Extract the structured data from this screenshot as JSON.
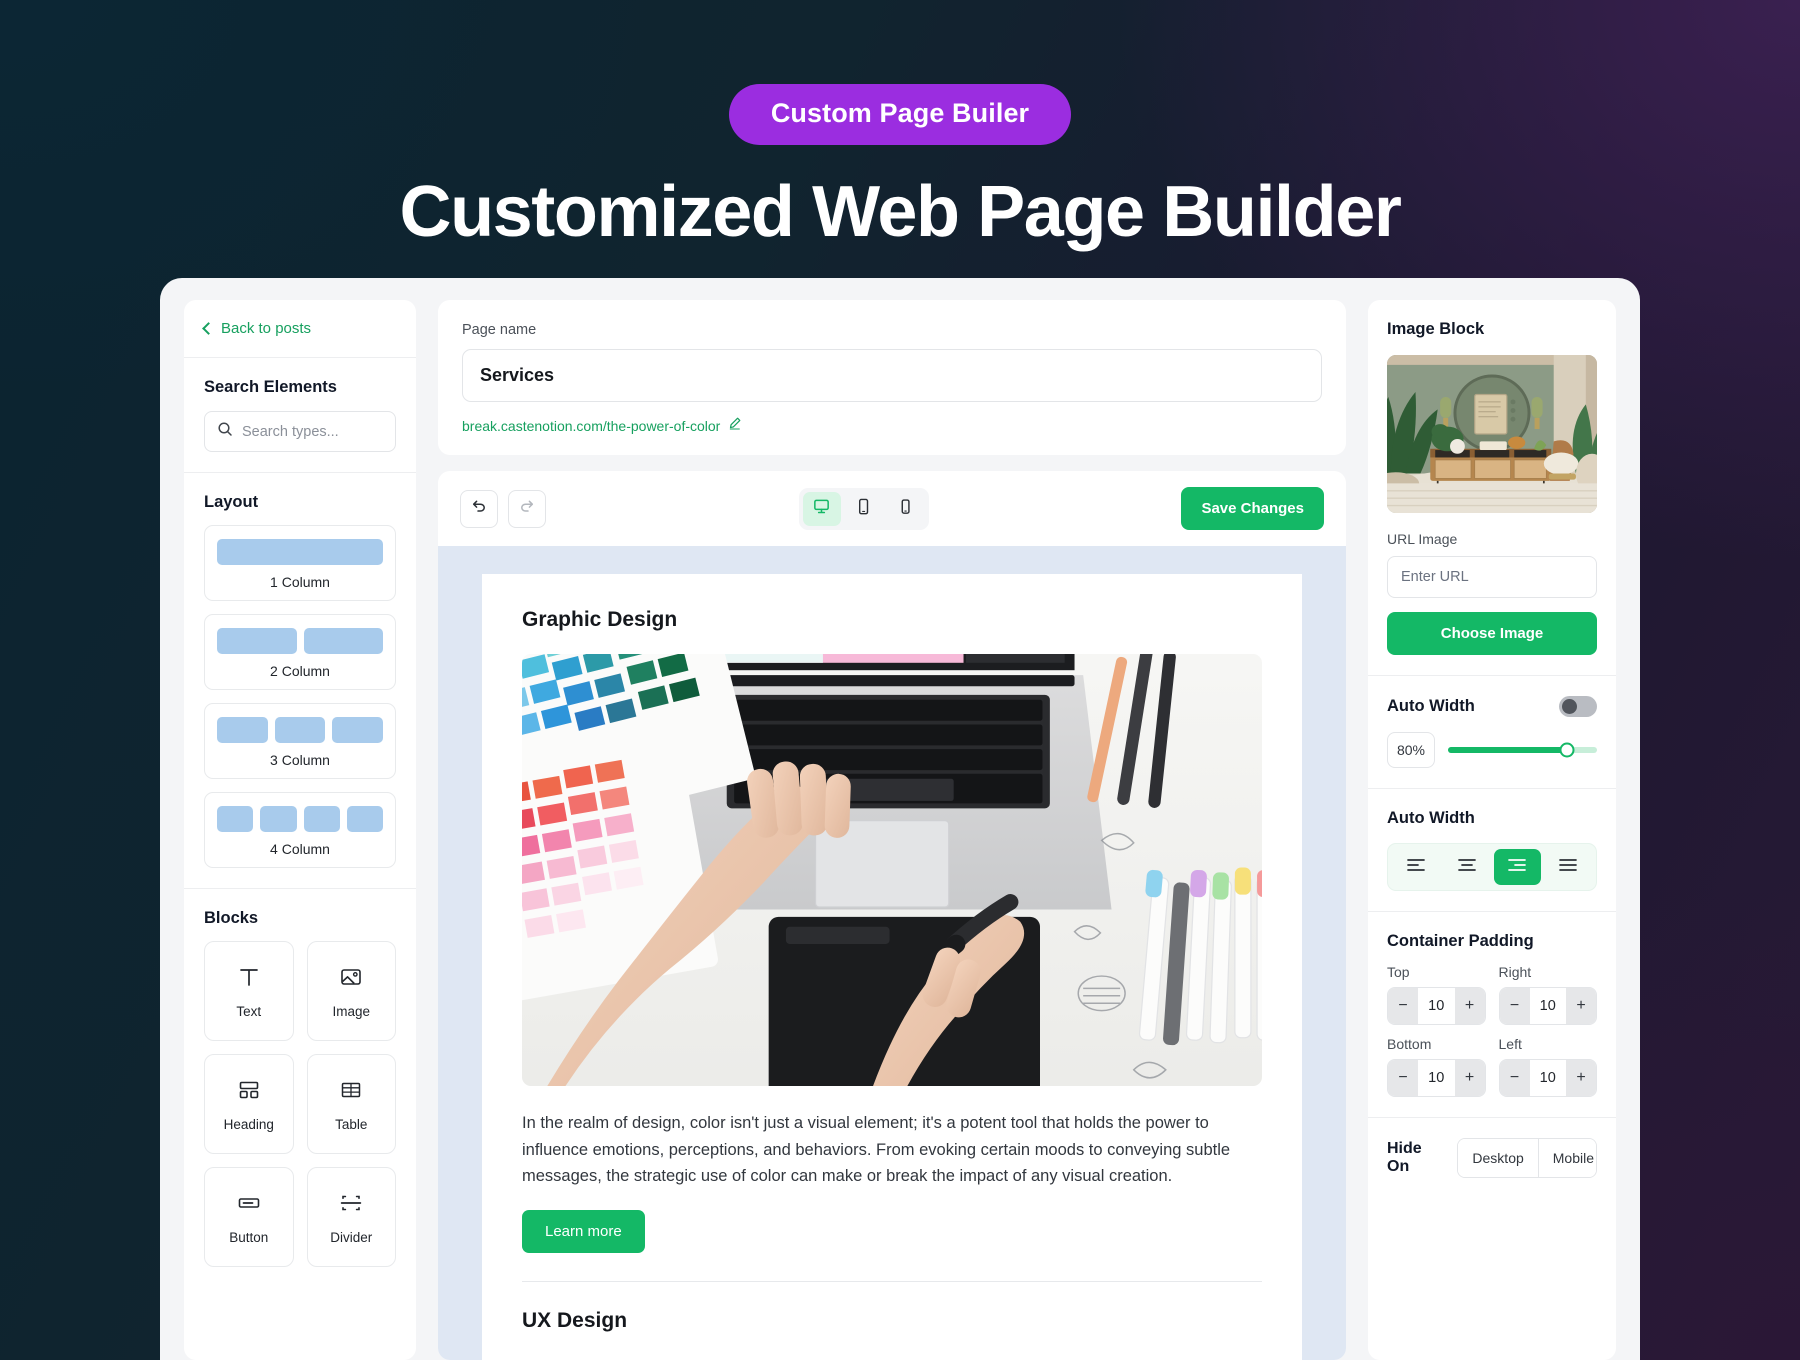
{
  "hero": {
    "badge": "Custom Page Builer",
    "title": "Customized Web Page Builder"
  },
  "sidebar": {
    "back_label": "Back to posts",
    "search_title": "Search Elements",
    "search_placeholder": "Search types...",
    "layout_title": "Layout",
    "layouts": [
      {
        "label": "1 Column",
        "cols": 1
      },
      {
        "label": "2 Column",
        "cols": 2
      },
      {
        "label": "3 Column",
        "cols": 3
      },
      {
        "label": "4 Column",
        "cols": 4
      }
    ],
    "blocks_title": "Blocks",
    "blocks": [
      {
        "label": "Text",
        "icon": "text-icon"
      },
      {
        "label": "Image",
        "icon": "image-icon"
      },
      {
        "label": "Heading",
        "icon": "heading-icon"
      },
      {
        "label": "Table",
        "icon": "table-icon"
      },
      {
        "label": "Button",
        "icon": "button-icon"
      },
      {
        "label": "Divider",
        "icon": "divider-icon"
      }
    ]
  },
  "page_meta": {
    "name_label": "Page name",
    "name_value": "Services",
    "url": "break.castenotion.com/the-power-of-color",
    "edit_icon": "pencil-icon"
  },
  "toolbar": {
    "undo_icon": "undo-arrow-icon",
    "redo_icon": "redo-arrow-icon",
    "devices": [
      {
        "name": "desktop",
        "active": true
      },
      {
        "name": "tablet",
        "active": false
      },
      {
        "name": "mobile",
        "active": false
      }
    ],
    "save_label": "Save Changes"
  },
  "canvas": {
    "heading": "Graphic Design",
    "image_alt": "designer hands on laptop with graphics tablet, color swatch fans and markers",
    "paragraph": "In the realm of design, color isn't just a visual element; it's a potent tool that holds the power to influence emotions, perceptions, and behaviors. From evoking certain moods to conveying subtle messages, the strategic use of color can make or break the impact of any visual creation.",
    "cta_label": "Learn more",
    "next_heading": "UX Design"
  },
  "inspector": {
    "title": "Image Block",
    "thumb_alt": "green interior wall with round mirror, plants and wooden sideboard",
    "url_label": "URL Image",
    "url_placeholder": "Enter URL",
    "choose_label": "Choose Image",
    "auto_width_label": "Auto Width",
    "auto_width_enabled": false,
    "width_value": "80%",
    "width_percent": 80,
    "alignment_label": "Auto Width",
    "alignments": [
      {
        "name": "align-left",
        "active": false
      },
      {
        "name": "align-center",
        "active": false
      },
      {
        "name": "align-right",
        "active": true
      },
      {
        "name": "align-justify",
        "active": false
      }
    ],
    "padding_title": "Container Padding",
    "padding": [
      {
        "label": "Top",
        "value": "10"
      },
      {
        "label": "Right",
        "value": "10"
      },
      {
        "label": "Bottom",
        "value": "10"
      },
      {
        "label": "Left",
        "value": "10"
      }
    ],
    "minus": "−",
    "plus": "+",
    "hide_label": "Hide On",
    "hide_options": [
      "Desktop",
      "Mobile"
    ]
  },
  "colors": {
    "badge": "#9b2de0",
    "accent_green": "#14b866",
    "link_green": "#17a05f",
    "canvas_bg": "#dfe7f3"
  }
}
